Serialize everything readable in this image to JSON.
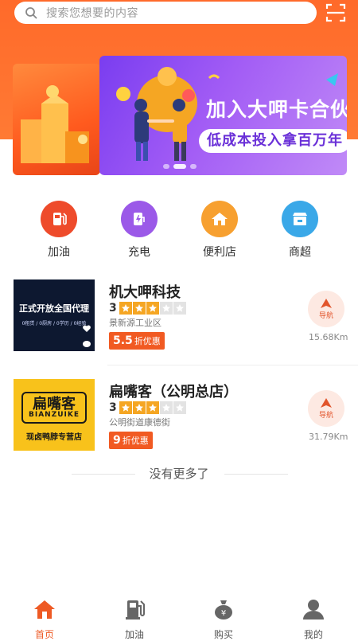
{
  "search": {
    "placeholder": "搜索您想要的内容"
  },
  "banner": {
    "title": "加入大呷卡合伙",
    "subtitle": "低成本投入拿百万年",
    "active_index": 1,
    "count": 3
  },
  "categories": [
    {
      "label": "加油",
      "icon": "gas-pump-icon",
      "color": "#ee4b2b"
    },
    {
      "label": "充电",
      "icon": "charger-icon",
      "color": "#9b59e8"
    },
    {
      "label": "便利店",
      "icon": "house-icon",
      "color": "#f7a030"
    },
    {
      "label": "商超",
      "icon": "store-icon",
      "color": "#3aa8e8"
    }
  ],
  "shops": [
    {
      "name": "机大呷科技",
      "rating": "3",
      "stars_filled": 3,
      "stars_total": 5,
      "address": "景新源工业区",
      "discount_value": "5.5",
      "discount_unit": "折优惠",
      "nav_label": "导航",
      "distance": "15.68Km",
      "thumb_text": "正式开放全国代理",
      "thumb_caption": "0租赁 / 0厨房 / 0学历 / 0经验"
    },
    {
      "name": "扁嘴客（公明总店）",
      "rating": "3",
      "stars_filled": 3,
      "stars_total": 5,
      "address": "公明街道康德街",
      "discount_value": "9",
      "discount_unit": "折优惠",
      "nav_label": "导航",
      "distance": "31.79Km",
      "thumb_logo": "扁嘴客",
      "thumb_logo_en": "BIANZUIKE",
      "thumb_caption": "现卤鸭脖专营店"
    }
  ],
  "footer_note": "没有更多了",
  "tabs": [
    {
      "label": "首页",
      "icon": "home-icon",
      "active": true
    },
    {
      "label": "加油",
      "icon": "fuel-icon",
      "active": false
    },
    {
      "label": "购买",
      "icon": "money-bag-icon",
      "active": false
    },
    {
      "label": "我的",
      "icon": "user-icon",
      "active": false
    }
  ],
  "colors": {
    "accent": "#ee5a24",
    "header": "#ff6a2a",
    "banner": "#8a45f2"
  }
}
